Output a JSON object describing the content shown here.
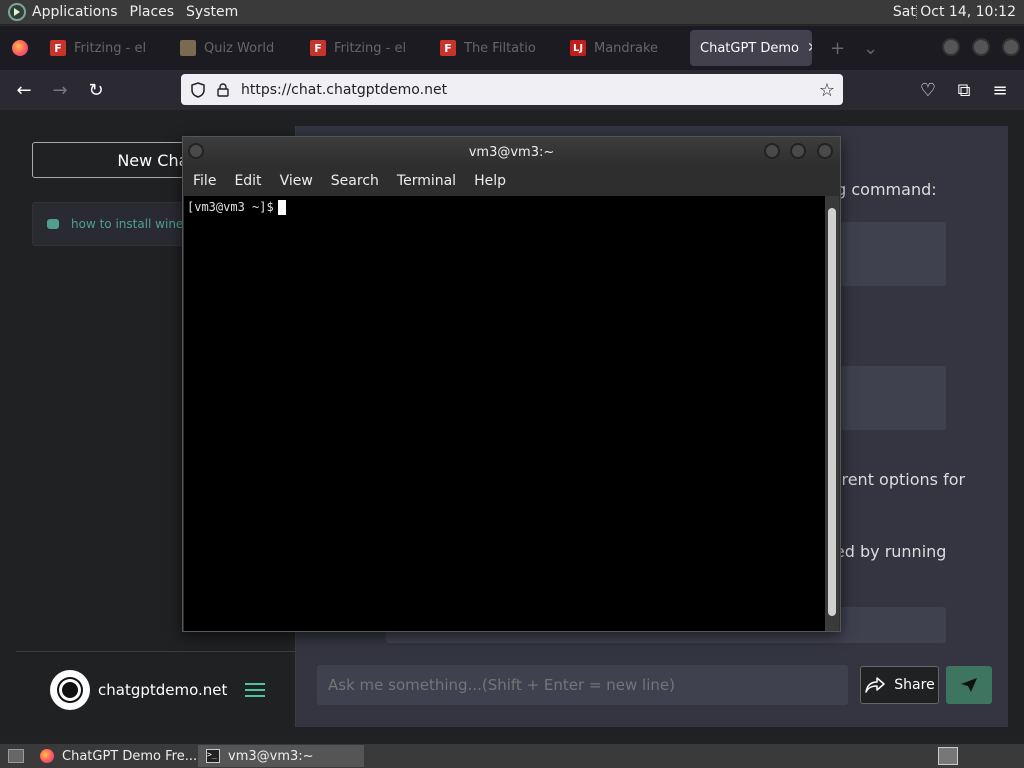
{
  "system_panel": {
    "menus": [
      "Applications",
      "Places",
      "System"
    ],
    "clock": "Sat Oct 14, 10:12"
  },
  "browser": {
    "tabs": [
      {
        "label": "Fritzing - el",
        "favicon": "F"
      },
      {
        "label": "Quiz World",
        "favicon": ""
      },
      {
        "label": "Fritzing - el",
        "favicon": "F"
      },
      {
        "label": "The Filtatio",
        "favicon": "F"
      },
      {
        "label": "Mandrake",
        "favicon": "LJ"
      },
      {
        "label": "ChatGPT Demo",
        "favicon": ""
      }
    ],
    "url": "https://chat.chatgptdemo.net"
  },
  "chat_app": {
    "new_chat_label": "New Chat",
    "history": [
      {
        "title": "how to install wine in"
      }
    ],
    "brand": "chatgptdemo.net",
    "answer_fragments": [
      "ng command:",
      "ferent options for",
      "lled by running"
    ],
    "prompt_placeholder": "Ask me something...(Shift + Enter = new line)",
    "share_label": "Share"
  },
  "terminal": {
    "title": "vm3@vm3:~",
    "menu": [
      "File",
      "Edit",
      "View",
      "Search",
      "Terminal",
      "Help"
    ],
    "prompt": "[vm3@vm3 ~]$"
  },
  "taskbar": {
    "items": [
      {
        "label": "ChatGPT Demo Fre...",
        "icon": "firefox-icon"
      },
      {
        "label": "vm3@vm3:~",
        "icon": "terminal-icon"
      }
    ]
  }
}
